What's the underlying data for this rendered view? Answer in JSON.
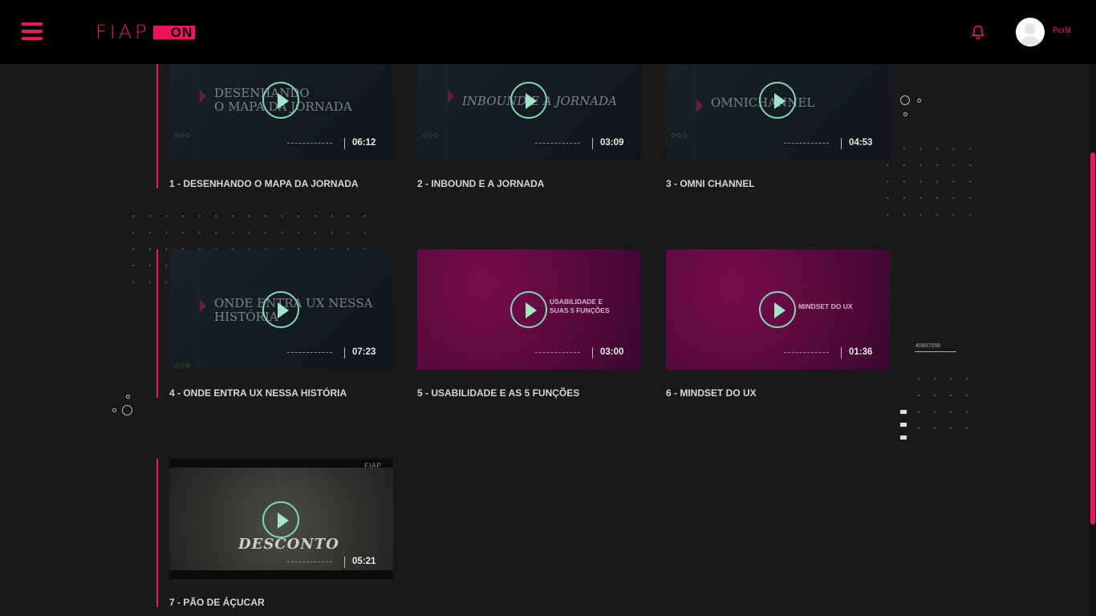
{
  "header": {
    "logo_text": "FIAP",
    "logo_badge": "ON",
    "profile_label": "Perfil",
    "icons": [
      "menu-icon",
      "bell-icon",
      "avatar-icon"
    ]
  },
  "side_number": "45897056",
  "colors": {
    "accent": "#ed145b",
    "play": "#7fd6b0",
    "background": "#191919",
    "header": "#000000"
  },
  "videos": [
    {
      "caption": "1 - DESENHANDO O MAPA DA JORNADA",
      "duration": "06:12",
      "thumb_title": "DESENHANDO\nO MAPA DA JORNADA"
    },
    {
      "caption": "2 - INBOUND E A JORNADA",
      "duration": "03:09",
      "thumb_title": "INBOUND E A JORNADA"
    },
    {
      "caption": "3 - OMNI CHANNEL",
      "duration": "04:53",
      "thumb_title": "OMNICHANNEL"
    },
    {
      "caption": "4 - ONDE ENTRA UX NESSA HISTÓRIA",
      "duration": "07:23",
      "thumb_title": "ONDE ENTRA UX NESSA\nHISTÓRIA"
    },
    {
      "caption": "5 - USABILIDADE E AS 5 FUNÇÕES",
      "duration": "03:00",
      "thumb_title": "USABILIDADE E\nSUAS 5 FUNÇÕES"
    },
    {
      "caption": "6 - MINDSET DO UX",
      "duration": "01:36",
      "thumb_title": "MINDSET DO UX"
    },
    {
      "caption": "7 - PÃO DE ÁÇUCAR",
      "duration": "05:21",
      "thumb_title": "DESCONTO"
    }
  ]
}
